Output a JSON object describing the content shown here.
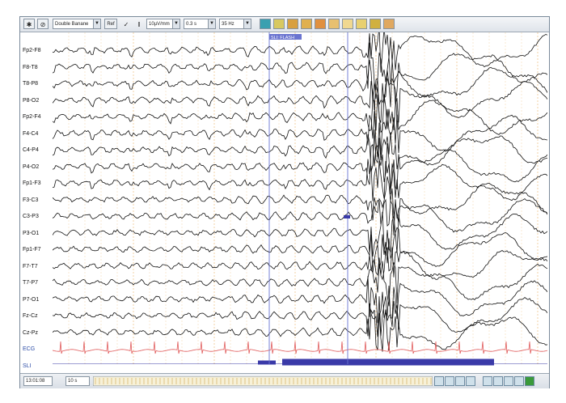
{
  "toolbar": {
    "montage": "Double Banane",
    "ref_label": "Ref",
    "sensitivity": "10µV/mm",
    "timebase": "0.3 s",
    "filter": "35 Hz"
  },
  "channels": [
    "Fp2-F8",
    "F8-T8",
    "T8-P8",
    "P8-O2",
    "Fp2-F4",
    "F4-C4",
    "C4-P4",
    "P4-O2",
    "Fp1-F3",
    "F3-C3",
    "C3-P3",
    "P3-O1",
    "Fp1-F7",
    "F7-T7",
    "T7-P7",
    "P7-O1",
    "Fz-Cz",
    "Cz-Pz",
    "ECG",
    "SLI"
  ],
  "marker_label": "SLI: FLASH",
  "status": {
    "time": "13:01:08",
    "page": "10 s"
  },
  "colors": {
    "eeg": "#111111",
    "ecg": "#e05a5a",
    "sli": "#3a3aa8",
    "cursor": "#6a74d0",
    "grid": "#f0c890",
    "channel_label_blue": "#2f4fa8"
  }
}
